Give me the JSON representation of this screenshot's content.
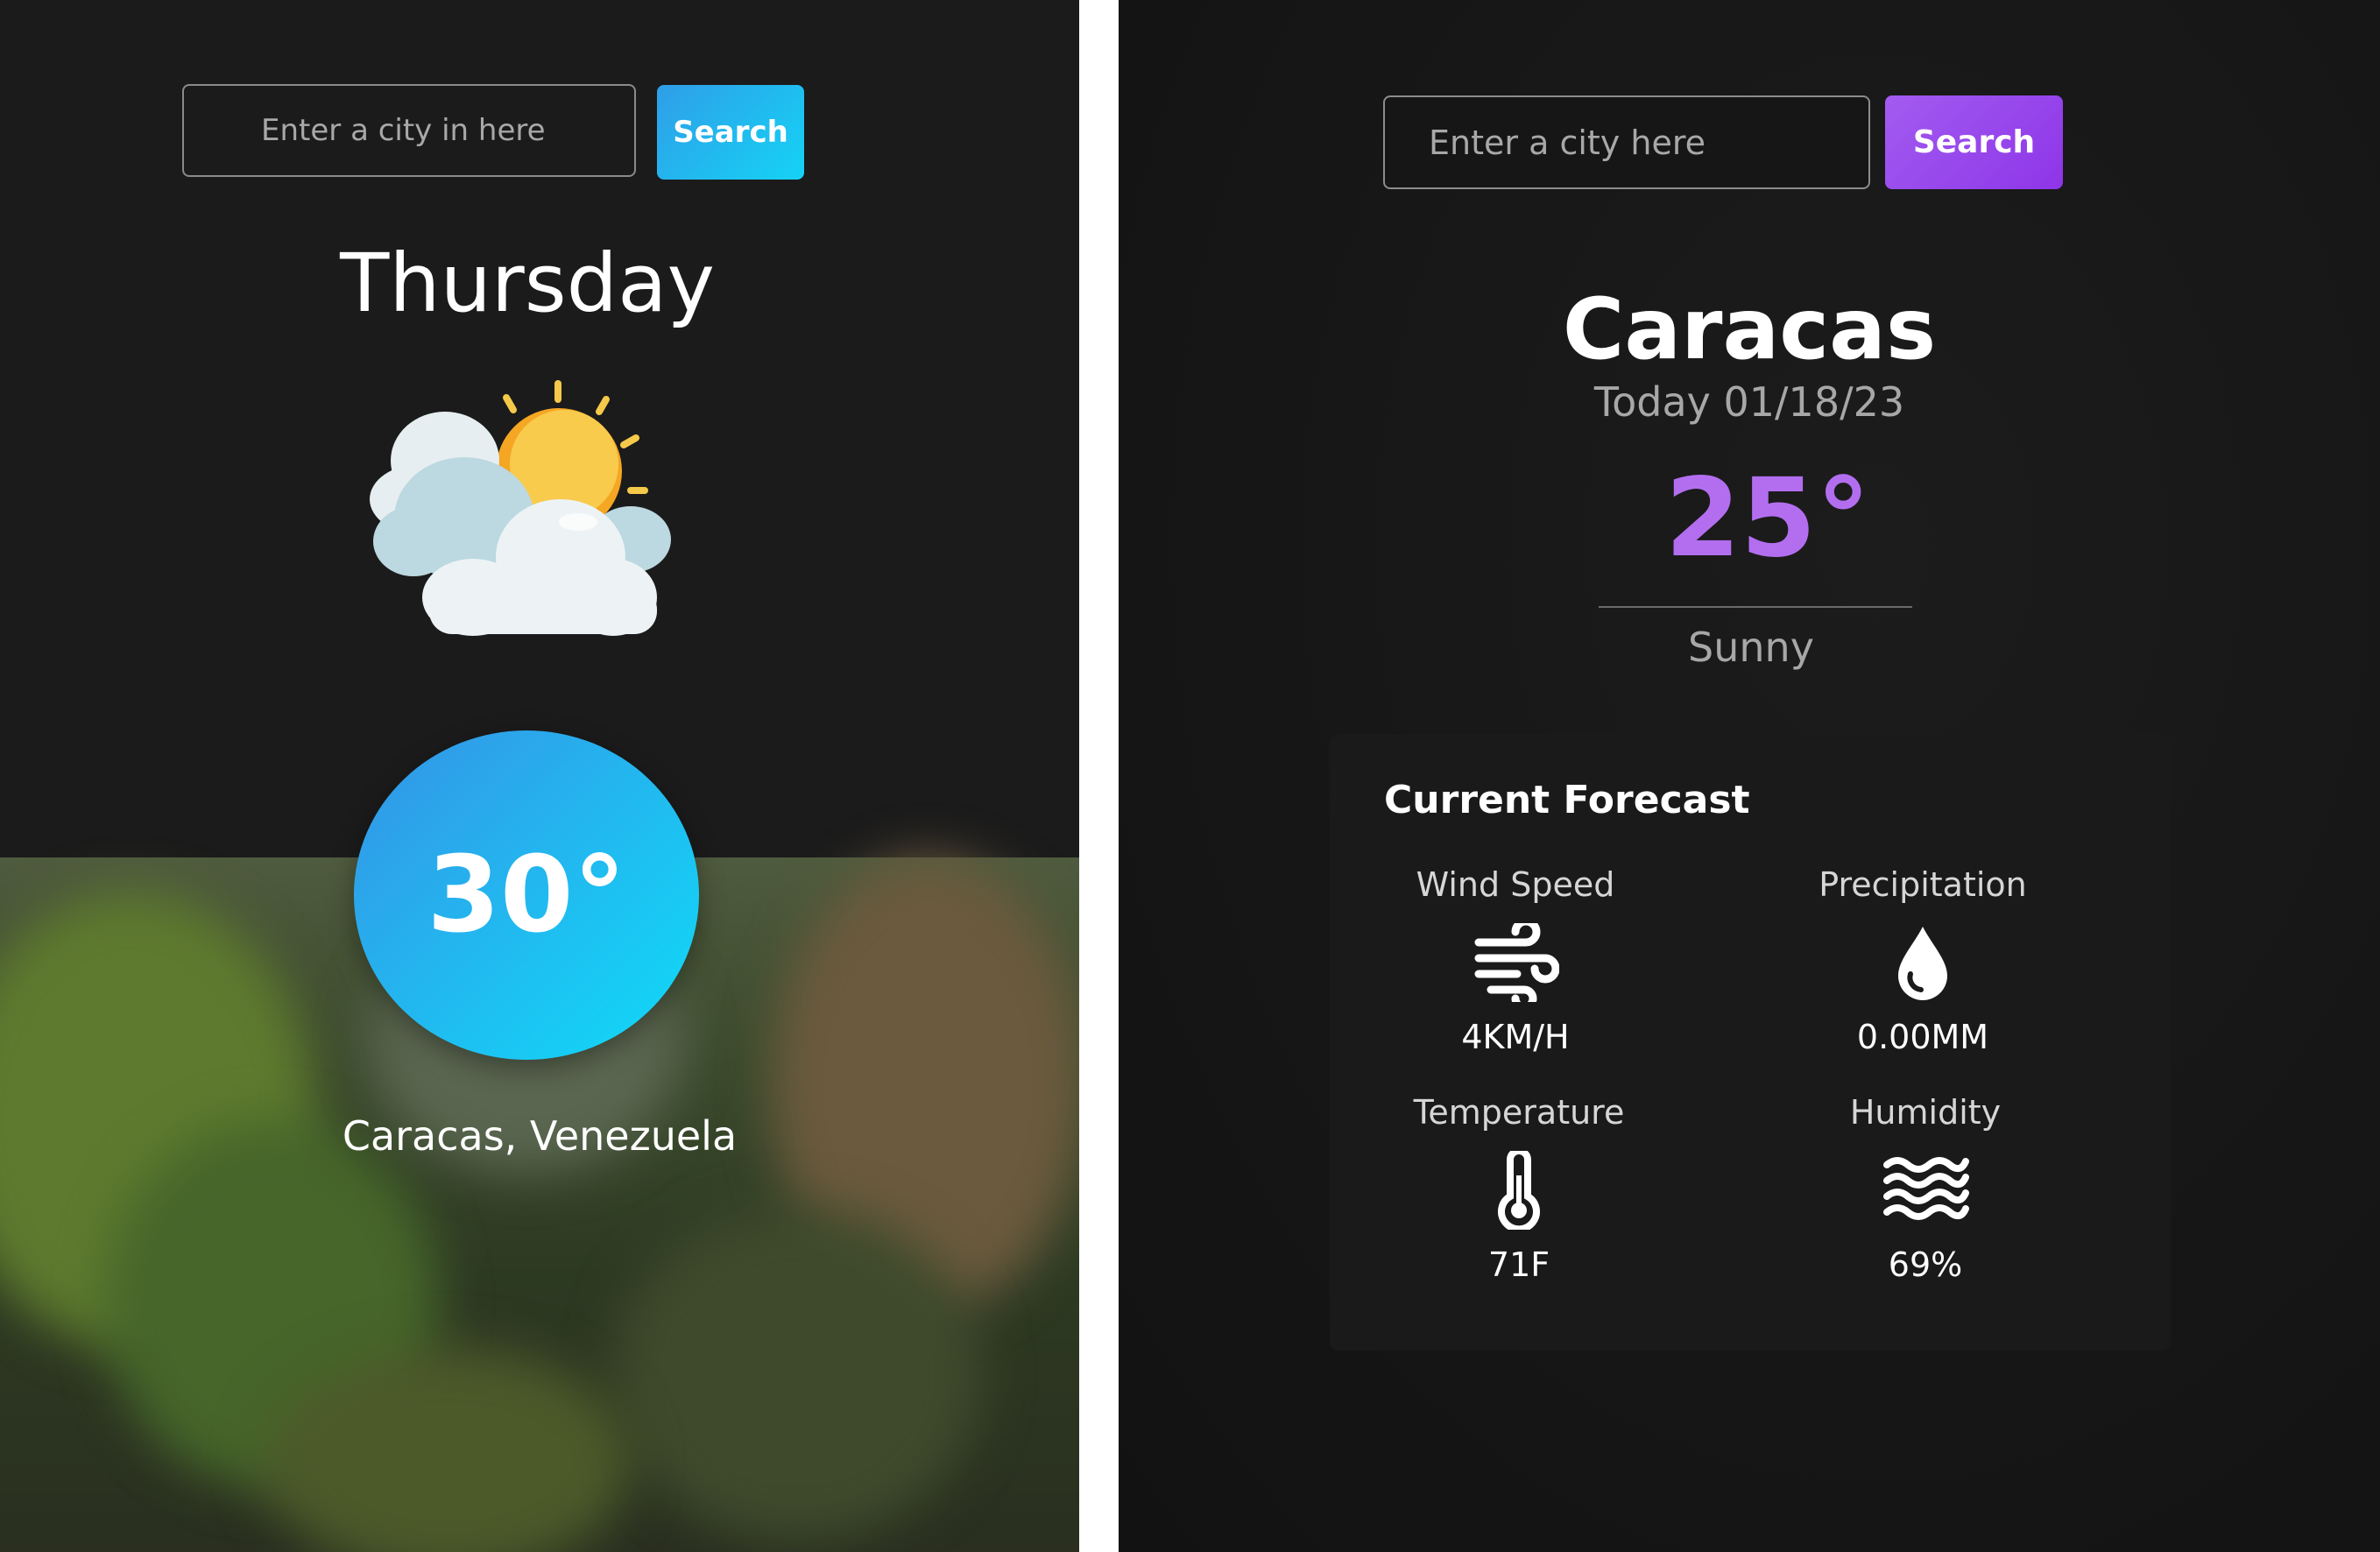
{
  "left_app": {
    "search": {
      "placeholder": "Enter a city in here",
      "button_label": "Search"
    },
    "day": "Thursday",
    "weather_icon": "partly-cloudy-icon",
    "temperature": "30°",
    "location": "Caracas, Venezuela",
    "colors": {
      "accent_start": "#2f9ee8",
      "accent_end": "#15d3f5",
      "background": "#1b1b1b"
    }
  },
  "right_app": {
    "search": {
      "placeholder": "Enter a city here",
      "button_label": "Search"
    },
    "city": "Caracas",
    "date": "Today 01/18/23",
    "temperature": "25°",
    "condition": "Sunny",
    "forecast": {
      "title": "Current Forecast",
      "items": [
        {
          "label": "Wind Speed",
          "icon": "wind-icon",
          "value": "4KM/H"
        },
        {
          "label": "Precipitation",
          "icon": "droplet-icon",
          "value": "0.00MM"
        },
        {
          "label": "Temperature",
          "icon": "thermometer-icon",
          "value": "71F"
        },
        {
          "label": "Humidity",
          "icon": "waves-icon",
          "value": "69%"
        }
      ]
    },
    "colors": {
      "accent": "#b36ef0",
      "button": "#9b4cee",
      "background": "#161616"
    }
  }
}
